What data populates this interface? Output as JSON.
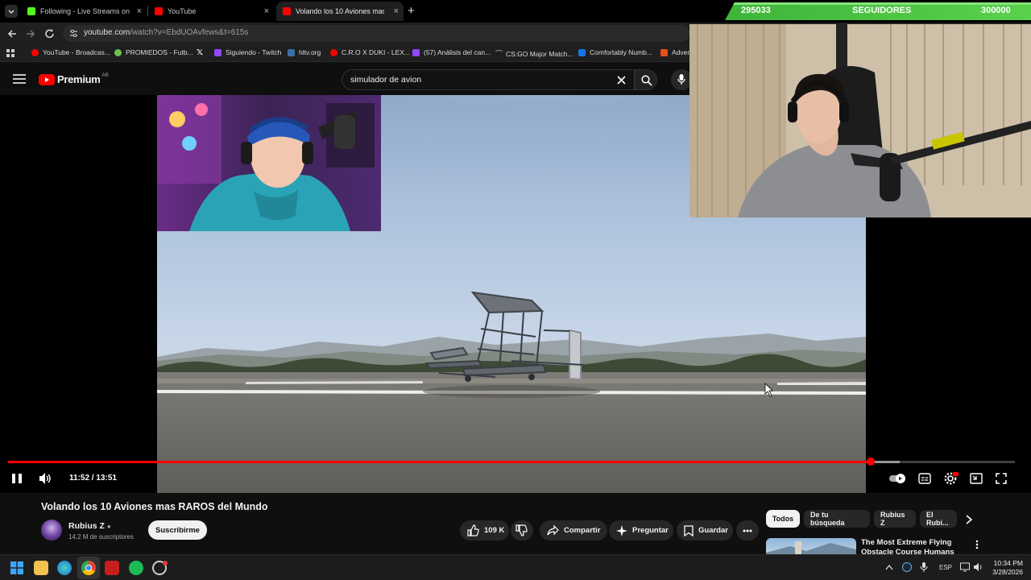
{
  "browser": {
    "tabs": [
      {
        "title": "Following - Live Streams on Kick",
        "favicon_color": "#53fc18"
      },
      {
        "title": "YouTube",
        "favicon_color": "#ff0000"
      },
      {
        "title": "Volando los 10 Aviones mas...",
        "favicon_color": "#ff0000"
      }
    ],
    "new_tab_label": "+",
    "url_host": "youtube.com",
    "url_rest": "/watch?v=EbdUOAvfews&t=615s",
    "bookmarks": [
      {
        "label": "YouTube - Broadcas...",
        "color": "#ff0000"
      },
      {
        "label": "PROMIEDOS - Futb...",
        "color": "#6cc04a"
      },
      {
        "label": "",
        "color": "#ffffff"
      },
      {
        "label": "Siguiendo - Twitch",
        "color": "#9146ff"
      },
      {
        "label": "hltv.org",
        "color": "#3b6ea8"
      },
      {
        "label": "C.R.O X DUKI - LEX...",
        "color": "#ff0000"
      },
      {
        "label": "(57) Análisis del can...",
        "color": "#9146ff"
      },
      {
        "label": "CS:GO Major Match...",
        "color": "#cccccc"
      },
      {
        "label": "Comfortably Numb...",
        "color": "#1a73e8"
      },
      {
        "label": "Adven",
        "color": "#e8501a"
      }
    ]
  },
  "youtube": {
    "logo_label": "Premium",
    "logo_region": "AR",
    "search_value": "simulador de avion"
  },
  "overlay": {
    "follow_current": "295033",
    "follow_label": "SEGUIDORES",
    "follow_goal": "300000"
  },
  "player": {
    "time_current": "11:52",
    "time_total": "13:51",
    "time_display": "11:52 / 13:51",
    "progress": 0.857
  },
  "video": {
    "title": "Volando los 10 Aviones mas RAROS del Mundo",
    "channel": "Rubius Z",
    "subscribers": "14,2 M de suscriptores",
    "subscribe_label": "Suscribirme",
    "likes": "109 K",
    "share_label": "Compartir",
    "ask_label": "Preguntar",
    "save_label": "Guardar"
  },
  "recommendations": {
    "chips": [
      "Todos",
      "De tu búsqueda",
      "Rubius Z",
      "El Rubi..."
    ],
    "first_title": "The Most Extreme Flying Obstacle Course Humans Hav..."
  },
  "taskbar": {
    "lang": "ESP",
    "time": "10:34 PM",
    "date": "3/28/2026"
  }
}
